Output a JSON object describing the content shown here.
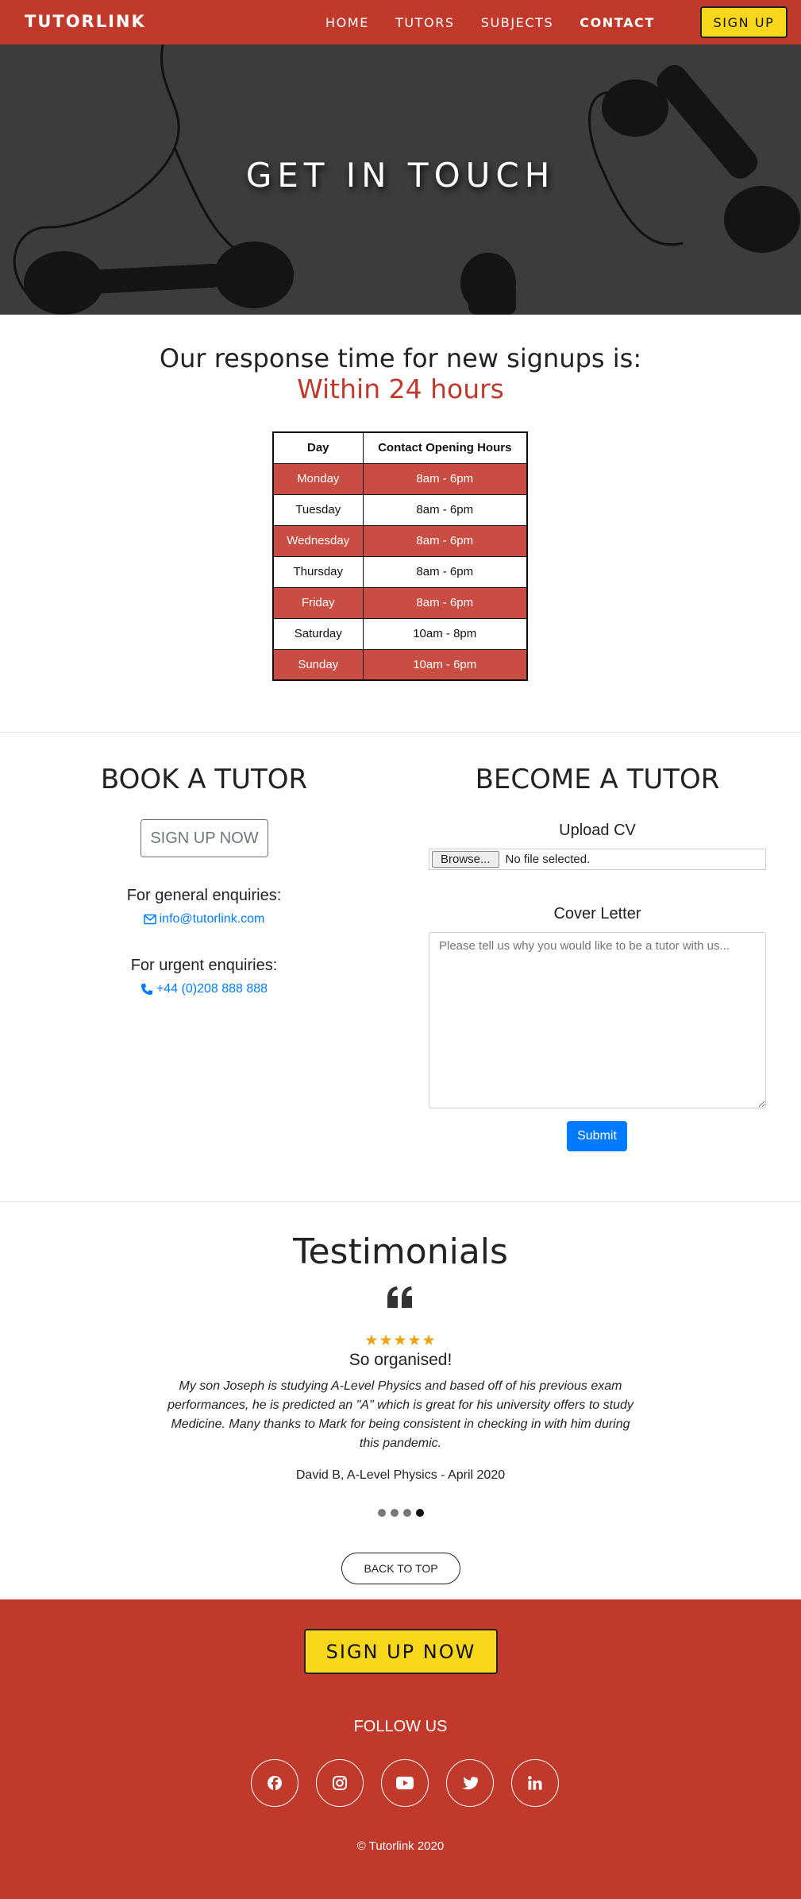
{
  "nav": {
    "brand": "TUTORLINK",
    "links": [
      "HOME",
      "TUTORS",
      "SUBJECTS",
      "CONTACT"
    ],
    "active": "CONTACT",
    "signup": "SIGN UP"
  },
  "hero": {
    "title": "GET IN TOUCH"
  },
  "response": {
    "line1": "Our response time for new signups is:",
    "line2": "Within 24 hours"
  },
  "hours_table": {
    "headers": [
      "Day",
      "Contact Opening Hours"
    ],
    "rows": [
      {
        "day": "Monday",
        "hours": "8am - 6pm"
      },
      {
        "day": "Tuesday",
        "hours": "8am - 6pm"
      },
      {
        "day": "Wednesday",
        "hours": "8am - 6pm"
      },
      {
        "day": "Thursday",
        "hours": "8am - 6pm"
      },
      {
        "day": "Friday",
        "hours": "8am - 6pm"
      },
      {
        "day": "Saturday",
        "hours": "10am - 8pm"
      },
      {
        "day": "Sunday",
        "hours": "10am - 6pm"
      }
    ]
  },
  "book": {
    "title": "BOOK A TUTOR",
    "signup_button": "SIGN UP NOW",
    "general_label": "For general enquiries:",
    "email": "info@tutorlink.com",
    "urgent_label": "For urgent enquiries:",
    "phone": "+44 (0)208 888 888"
  },
  "become": {
    "title": "BECOME A TUTOR",
    "upload_label": "Upload CV",
    "browse_button": "Browse...",
    "file_status": "No file selected.",
    "cover_label": "Cover Letter",
    "cover_placeholder": "Please tell us why you would like to be a tutor with us...",
    "submit": "Submit"
  },
  "testimonials": {
    "title": "Testimonials",
    "stars": "★★★★★",
    "rating": 5,
    "heading": "So organised!",
    "body": "My son Joseph is studying A-Level Physics and based off of his previous exam performances, he is predicted an \"A\" which is great for his university offers to study Medicine. Many thanks to Mark for being consistent in checking in with him during this pandemic.",
    "author": "David B, A-Level Physics - April 2020",
    "slide_count": 4,
    "active_slide": 4
  },
  "back_to_top": "BACK TO TOP",
  "footer": {
    "signup": "SIGN UP NOW",
    "follow": "FOLLOW US",
    "socials": [
      "facebook-icon",
      "instagram-icon",
      "youtube-icon",
      "twitter-icon",
      "linkedin-icon"
    ],
    "copyright": "© Tutorlink 2020"
  },
  "colors": {
    "brand_red": "#c0392b",
    "table_red": "#c94d43",
    "yellow": "#f9d71c",
    "link_blue": "#007bff",
    "star_gold": "#f1a20b"
  }
}
